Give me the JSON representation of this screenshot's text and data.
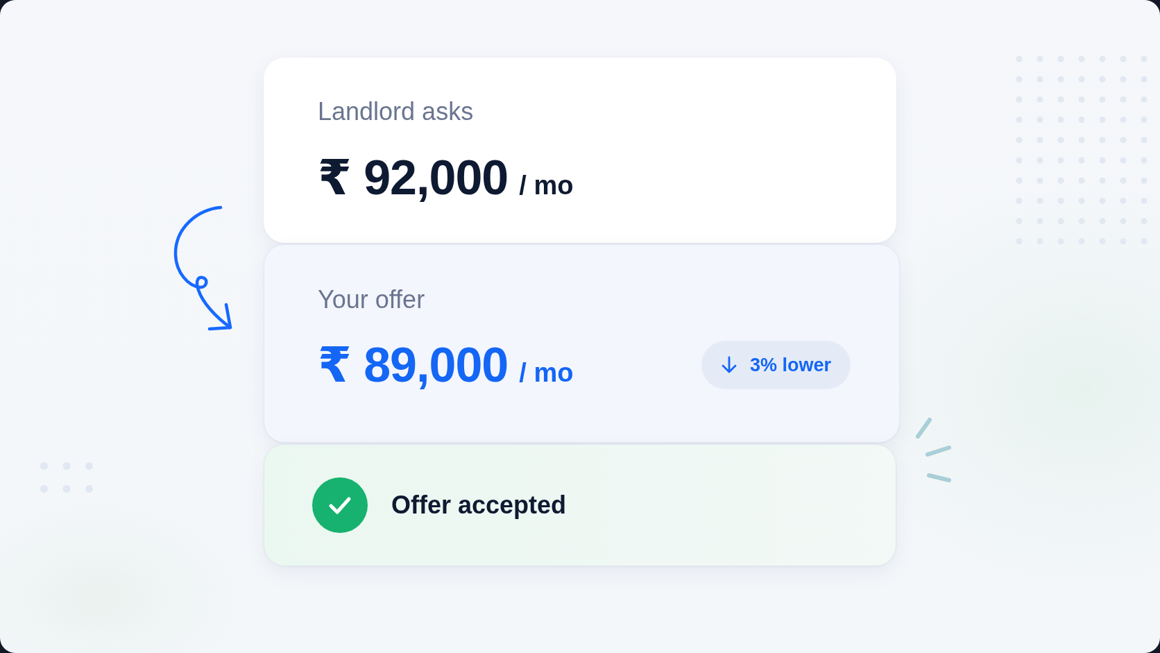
{
  "cards": [
    {
      "kind": "price",
      "label": "Landlord asks",
      "amount": "₹ 92,000",
      "unit": "/ mo",
      "highlight": false
    },
    {
      "kind": "price",
      "label": "Your offer",
      "amount": "₹ 89,000",
      "unit": "/ mo",
      "highlight": true,
      "badge": {
        "text": "3% lower"
      }
    },
    {
      "kind": "status",
      "text": "Offer accepted"
    }
  ]
}
